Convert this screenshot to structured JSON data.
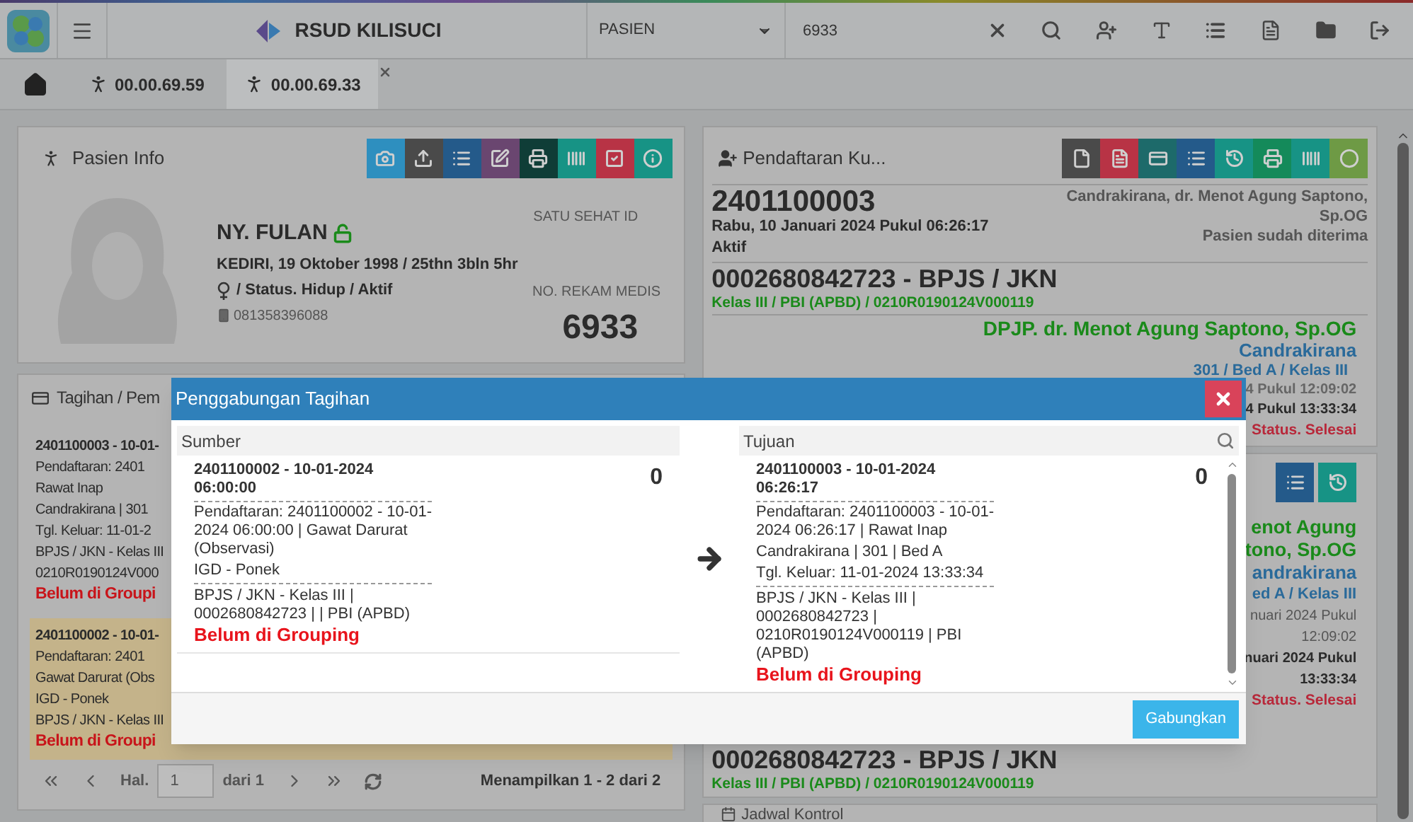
{
  "topbar": {
    "app_name": "RSUD KILISUCI",
    "search_type": "PASIEN",
    "search_value": "6933"
  },
  "tabs": [
    {
      "label": "00.00.69.59",
      "selected": false,
      "closable": false
    },
    {
      "label": "00.00.69.33",
      "selected": true,
      "closable": true
    }
  ],
  "patient_info": {
    "title": "Pasien Info",
    "name": "NY. FULAN",
    "locked": false,
    "birth": "KEDIRI, 19 Oktober 1998 / 25thn 3bln 5hr",
    "status": "/ Status. Hidup / Aktif",
    "phone": "081358396088",
    "satu_sehat_label": "SATU SEHAT ID",
    "rm_label": "NO. REKAM MEDIS",
    "rm_number": "6933"
  },
  "billing": {
    "title": "Tagihan / Pem",
    "items": [
      {
        "selected": false,
        "lines": [
          "2401100003 - 10-01-",
          "Pendaftaran: 2401",
          "Rawat Inap",
          "Candrakirana | 301",
          "Tgl. Keluar: 11-01-2",
          "BPJS / JKN - Kelas III",
          "0210R0190124V000"
        ],
        "status": "Belum di Groupi"
      },
      {
        "selected": true,
        "lines": [
          "2401100002 - 10-01-",
          "Pendaftaran: 2401",
          "Gawat Darurat (Obs",
          "IGD - Ponek",
          "BPJS / JKN - Kelas III"
        ],
        "status": "Belum di Groupi"
      }
    ],
    "pagination": {
      "page_label": "Hal.",
      "page": "1",
      "of": "dari 1",
      "summary": "Menampilkan 1 - 2 dari 2"
    }
  },
  "registration": {
    "title": "Pendaftaran Ku...",
    "number": "2401100003",
    "date": "Rabu, 10 Januari 2024 Pukul 06:26:17",
    "state": "Aktif",
    "unit": "Candrakirana, dr. Menot Agung Saptono, Sp.OG",
    "accept": "Pasien sudah diterima",
    "insurance": "0002680842723 - BPJS / JKN",
    "insurance_detail": "Kelas III / PBI (APBD) / 0210R0190124V000119",
    "dpjp": "DPJP. dr. Menot Agung Saptono, Sp.OG",
    "ward": "Candrakirana",
    "bed": "301 / Bed A / Kelas III",
    "in_time": "4 Pukul 12:09:02",
    "out_time": "4 Pukul 13:33:34",
    "status": "Status. Selesai"
  },
  "registration_2": {
    "dpjp_lines": [
      "enot Agung",
      "tono, Sp.OG"
    ],
    "ward": "andrakirana",
    "bed": "ed A / Kelas III",
    "in_time_lines": [
      "nuari 2024 Pukul",
      "12:09:02"
    ],
    "out_time_lines": [
      "nuari 2024 Pukul",
      "13:33:34"
    ],
    "status": "Status. Selesai",
    "insurance": "0002680842723 - BPJS / JKN",
    "insurance_detail": "Kelas III / PBI (APBD) / 0210R0190124V000119"
  },
  "schedule": {
    "title": "Jadwal Kontrol"
  },
  "dialog": {
    "title": "Penggabungan Tagihan",
    "button": "Gabungkan",
    "source": {
      "heading": "Sumber",
      "item": {
        "title": "2401100002 - 10-01-2024 06:00:00",
        "amount": "0",
        "details": [
          "Pendaftaran: 2401100002 - 10-01-2024 06:00:00 | Gawat Darurat (Observasi)",
          "IGD - Ponek"
        ],
        "payer": "BPJS / JKN - Kelas III | 0002680842723 | | PBI (APBD)",
        "status": "Belum di Grouping"
      }
    },
    "target": {
      "heading": "Tujuan",
      "item": {
        "title": "2401100003 - 10-01-2024 06:26:17",
        "amount": "0",
        "details": [
          "Pendaftaran: 2401100003 - 10-01-2024 06:26:17 | Rawat Inap",
          "Candrakirana | 301 | Bed A",
          "Tgl. Keluar: 11-01-2024 13:33:34"
        ],
        "payer": "BPJS / JKN - Kelas III | 0002680842723 | 0210R0190124V000119 | PBI (APBD)",
        "status": "Belum di Grouping"
      }
    }
  }
}
